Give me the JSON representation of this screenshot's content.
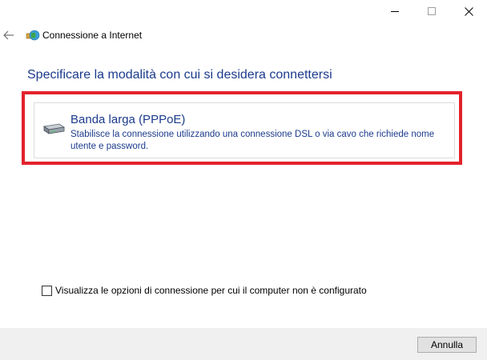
{
  "window": {
    "title": "Connessione a Internet",
    "caption_buttons": [
      "minimize",
      "maximize",
      "close"
    ]
  },
  "header": {
    "back_icon": "back-arrow-icon",
    "app_icon": "network-globe-icon",
    "title": "Connessione a Internet"
  },
  "main": {
    "heading": "Specificare la modalità con cui si desidera connettersi",
    "options": [
      {
        "icon": "broadband-modem-icon",
        "title": "Banda larga (PPPoE)",
        "description": "Stabilisce la connessione utilizzando una connessione DSL o via cavo che richiede nome utente e password."
      }
    ],
    "show_unconfigured_checkbox": {
      "label": "Visualizza le opzioni di connessione per cui il computer non è configurato",
      "checked": false
    }
  },
  "footer": {
    "cancel_label": "Annulla"
  },
  "colors": {
    "link_blue": "#1c3b8c",
    "highlight_red": "#e3222b",
    "footer_bg": "#f0f0f0"
  }
}
